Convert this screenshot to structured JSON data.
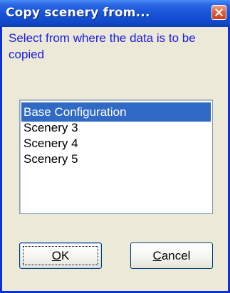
{
  "window": {
    "title": "Copy scenery from...",
    "close_icon": "close-icon"
  },
  "prompt": "Select from where the data is to be copied",
  "list": {
    "items": [
      {
        "label": "Base Configuration",
        "selected": true
      },
      {
        "label": "Scenery 3",
        "selected": false
      },
      {
        "label": "Scenery 4",
        "selected": false
      },
      {
        "label": "Scenery 5",
        "selected": false
      }
    ]
  },
  "buttons": {
    "ok": {
      "mnemonic": "O",
      "rest": "K"
    },
    "cancel": {
      "mnemonic": "C",
      "rest": "ancel"
    }
  },
  "colors": {
    "titlebar": "#1753D8",
    "selection": "#316AC5",
    "prompt_text": "#1A1AE6",
    "dialog_bg": "#ECE9D8"
  }
}
